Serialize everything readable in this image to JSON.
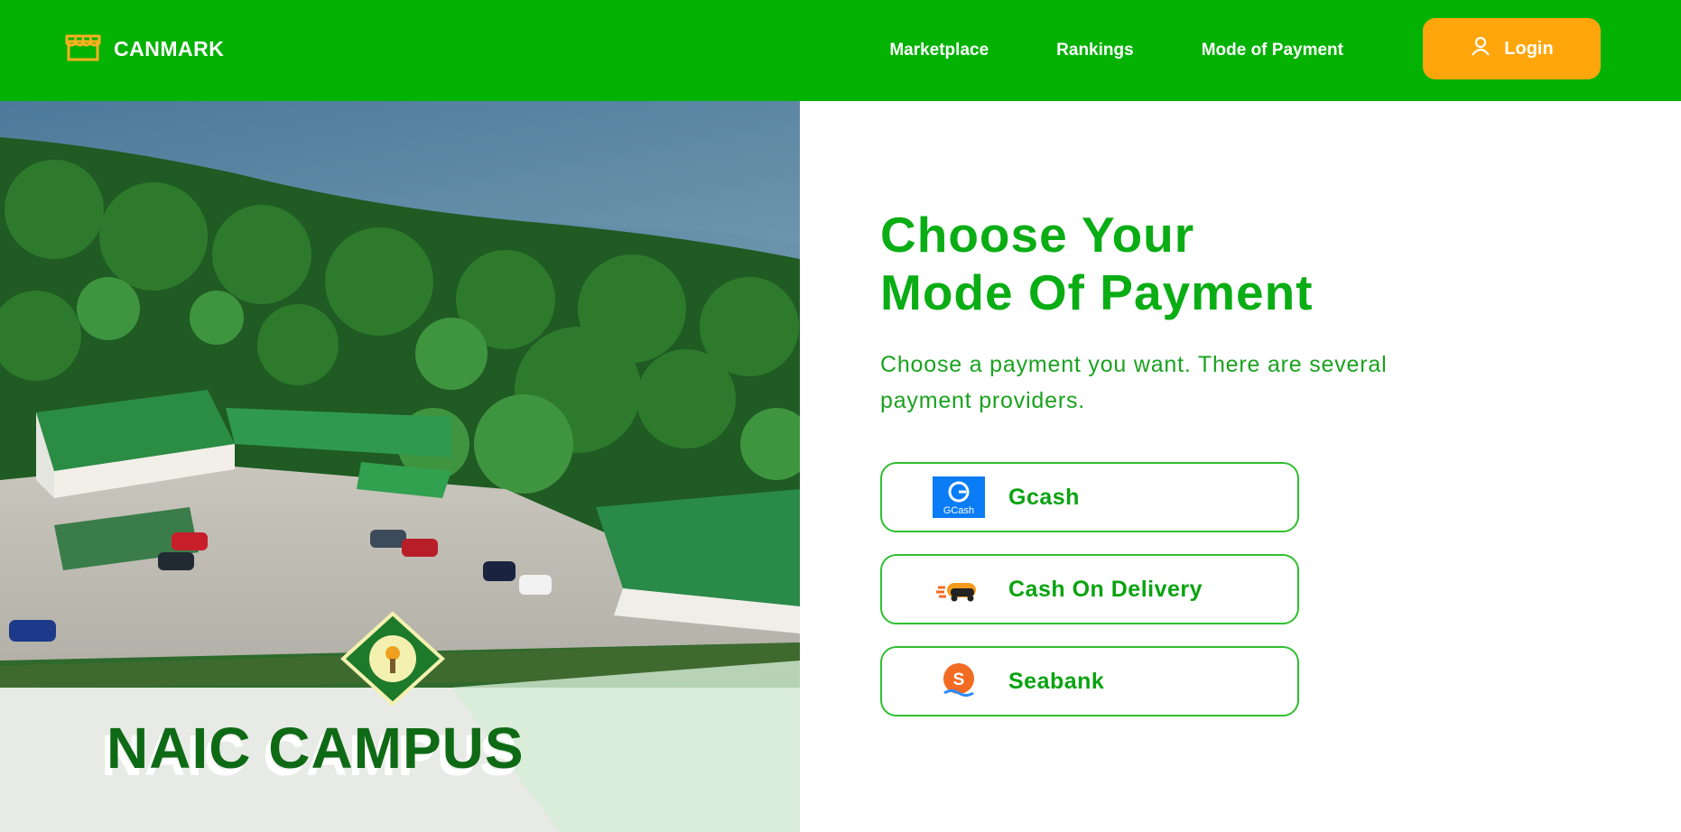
{
  "brand": {
    "name": "CANMARK",
    "icon": "store-icon"
  },
  "nav": {
    "links": [
      "Marketplace",
      "Rankings",
      "Mode of Payment"
    ],
    "login_label": "Login",
    "login_icon": "user-icon"
  },
  "hero": {
    "caption": "NAIC CAMPUS",
    "logo": "campus-seal"
  },
  "main": {
    "title_line1": "Choose Your",
    "title_line2": "Mode Of Payment",
    "subtitle": "Choose a payment you want. There are several payment providers.",
    "options": [
      {
        "label": "Gcash",
        "icon": "gcash-icon",
        "icon_text": "GCash"
      },
      {
        "label": "Cash On Delivery",
        "icon": "delivery-icon"
      },
      {
        "label": "Seabank",
        "icon": "seabank-icon",
        "icon_text": "S"
      }
    ]
  },
  "colors": {
    "navbar": "#03b203",
    "accent_green": "#0aad14",
    "login_orange": "#ffa60c",
    "gcash_blue": "#0a7cf5",
    "seabank_orange": "#f26b22"
  }
}
